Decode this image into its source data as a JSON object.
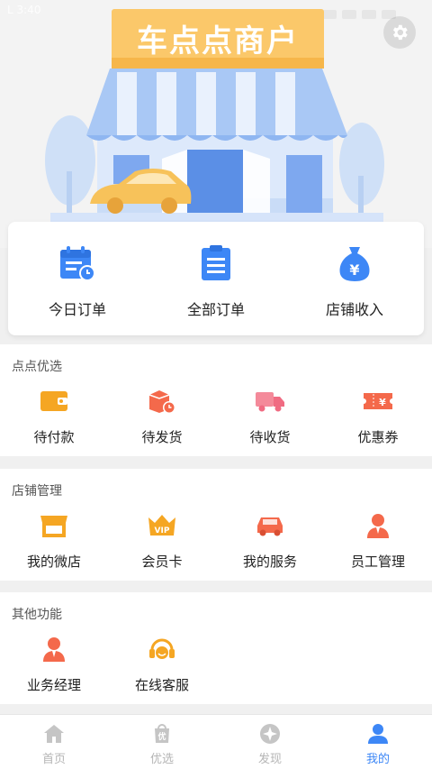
{
  "status_bar": {
    "left_text": "L 3:40"
  },
  "hero": {
    "shop_sign": "车点点商户"
  },
  "top_actions": [
    {
      "label": "今日订单",
      "icon": "calendar-clock-icon"
    },
    {
      "label": "全部订单",
      "icon": "clipboard-list-icon"
    },
    {
      "label": "店铺收入",
      "icon": "money-bag-icon"
    }
  ],
  "sections": [
    {
      "title": "点点优选",
      "items": [
        {
          "label": "待付款",
          "icon": "wallet-icon"
        },
        {
          "label": "待发货",
          "icon": "box-clock-icon"
        },
        {
          "label": "待收货",
          "icon": "truck-icon"
        },
        {
          "label": "优惠券",
          "icon": "coupon-icon"
        }
      ]
    },
    {
      "title": "店铺管理",
      "items": [
        {
          "label": "我的微店",
          "icon": "store-icon"
        },
        {
          "label": "会员卡",
          "icon": "vip-crown-icon"
        },
        {
          "label": "我的服务",
          "icon": "car-icon"
        },
        {
          "label": "员工管理",
          "icon": "staff-icon"
        }
      ]
    },
    {
      "title": "其他功能",
      "items": [
        {
          "label": "业务经理",
          "icon": "manager-icon"
        },
        {
          "label": "在线客服",
          "icon": "headset-icon"
        }
      ]
    }
  ],
  "tabs": [
    {
      "label": "首页",
      "icon": "home-icon",
      "active": false
    },
    {
      "label": "优选",
      "icon": "bag-icon",
      "active": false
    },
    {
      "label": "发现",
      "icon": "compass-icon",
      "active": false
    },
    {
      "label": "我的",
      "icon": "user-icon",
      "active": true
    }
  ],
  "colors": {
    "accent": "#3d87f6",
    "orange": "#f5a623",
    "red": "#f4694b"
  }
}
